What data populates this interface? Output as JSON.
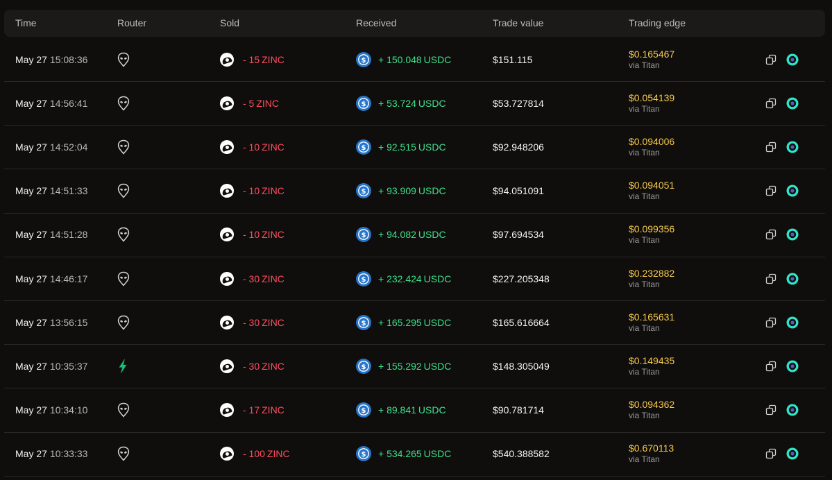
{
  "header": {
    "time": "Time",
    "router": "Router",
    "sold": "Sold",
    "received": "Received",
    "trade_value": "Trade value",
    "trading_edge": "Trading edge"
  },
  "colors": {
    "negative": "#ff4d5e",
    "positive": "#3fe08c",
    "edge": "#f7c948",
    "usdc": "#2775ca",
    "teal": "#2ee6c4"
  },
  "rows": [
    {
      "date": "May 27",
      "time": "15:08:36",
      "router_icon": "alien-head-icon",
      "sold": "- 15",
      "sold_symbol": "ZINC",
      "received": "+ 150.048",
      "received_symbol": "USDC",
      "trade_value": "$151.115",
      "edge": "$0.165467",
      "via": "via Titan"
    },
    {
      "date": "May 27",
      "time": "14:56:41",
      "router_icon": "alien-head-icon",
      "sold": "- 5",
      "sold_symbol": "ZINC",
      "received": "+ 53.724",
      "received_symbol": "USDC",
      "trade_value": "$53.727814",
      "edge": "$0.054139",
      "via": "via Titan"
    },
    {
      "date": "May 27",
      "time": "14:52:04",
      "router_icon": "alien-head-icon",
      "sold": "- 10",
      "sold_symbol": "ZINC",
      "received": "+ 92.515",
      "received_symbol": "USDC",
      "trade_value": "$92.948206",
      "edge": "$0.094006",
      "via": "via Titan"
    },
    {
      "date": "May 27",
      "time": "14:51:33",
      "router_icon": "alien-head-icon",
      "sold": "- 10",
      "sold_symbol": "ZINC",
      "received": "+ 93.909",
      "received_symbol": "USDC",
      "trade_value": "$94.051091",
      "edge": "$0.094051",
      "via": "via Titan"
    },
    {
      "date": "May 27",
      "time": "14:51:28",
      "router_icon": "alien-head-icon",
      "sold": "- 10",
      "sold_symbol": "ZINC",
      "received": "+ 94.082",
      "received_symbol": "USDC",
      "trade_value": "$97.694534",
      "edge": "$0.099356",
      "via": "via Titan"
    },
    {
      "date": "May 27",
      "time": "14:46:17",
      "router_icon": "alien-head-icon",
      "sold": "- 30",
      "sold_symbol": "ZINC",
      "received": "+ 232.424",
      "received_symbol": "USDC",
      "trade_value": "$227.205348",
      "edge": "$0.232882",
      "via": "via Titan"
    },
    {
      "date": "May 27",
      "time": "13:56:15",
      "router_icon": "alien-head-icon",
      "sold": "- 30",
      "sold_symbol": "ZINC",
      "received": "+ 165.295",
      "received_symbol": "USDC",
      "trade_value": "$165.616664",
      "edge": "$0.165631",
      "via": "via Titan"
    },
    {
      "date": "May 27",
      "time": "10:35:37",
      "router_icon": "lightning-bolt-icon",
      "sold": "- 30",
      "sold_symbol": "ZINC",
      "received": "+ 155.292",
      "received_symbol": "USDC",
      "trade_value": "$148.305049",
      "edge": "$0.149435",
      "via": "via Titan"
    },
    {
      "date": "May 27",
      "time": "10:34:10",
      "router_icon": "alien-head-icon",
      "sold": "- 17",
      "sold_symbol": "ZINC",
      "received": "+ 89.841",
      "received_symbol": "USDC",
      "trade_value": "$90.781714",
      "edge": "$0.094362",
      "via": "via Titan"
    },
    {
      "date": "May 27",
      "time": "10:33:33",
      "router_icon": "alien-head-icon",
      "sold": "- 100",
      "sold_symbol": "ZINC",
      "received": "+ 534.265",
      "received_symbol": "USDC",
      "trade_value": "$540.388582",
      "edge": "$0.670113",
      "via": "via Titan"
    }
  ]
}
